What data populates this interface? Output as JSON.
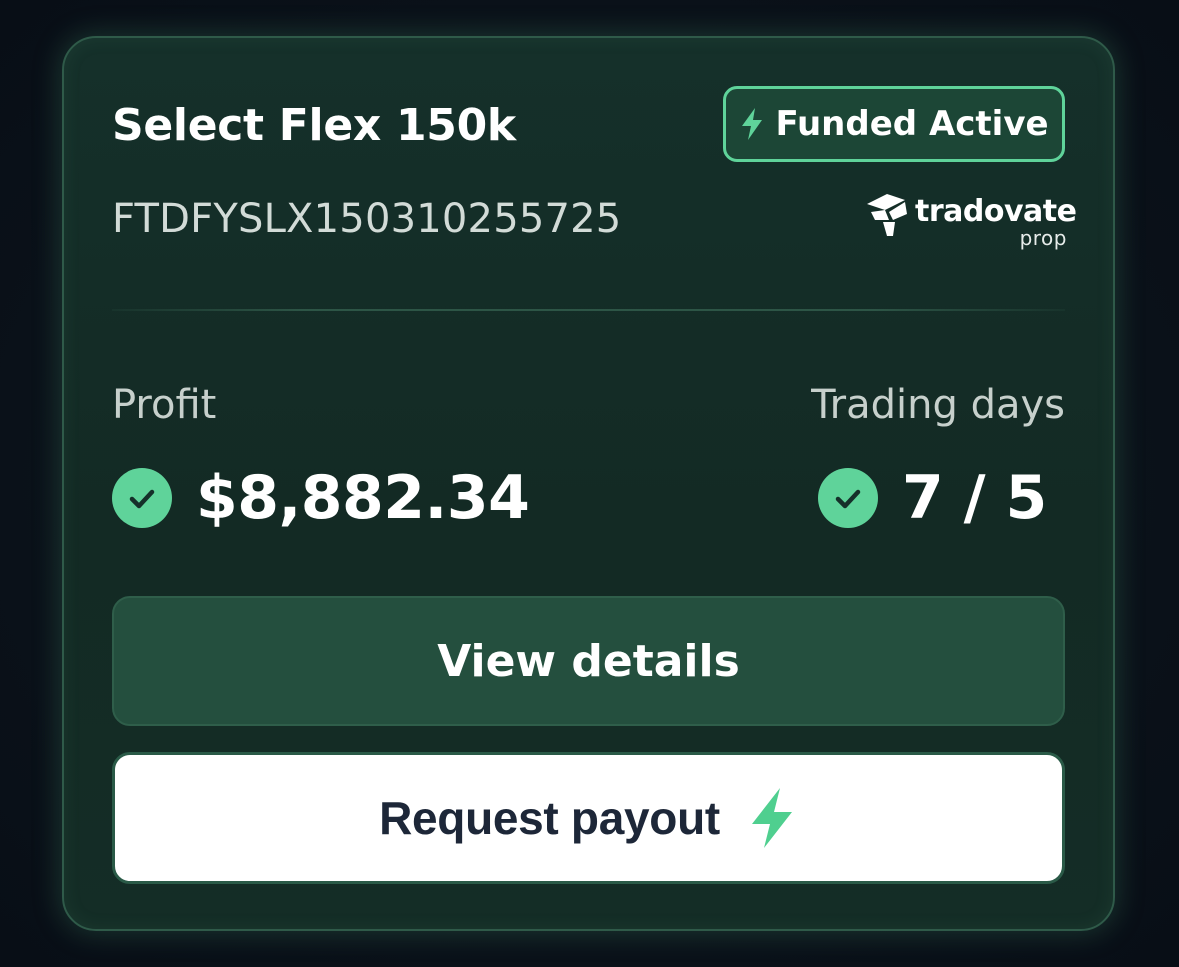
{
  "account": {
    "title": "Select Flex 150k",
    "id": "FTDFYSLX150310255725",
    "status_badge": "Funded Active",
    "status_icon": "lightning-bolt-icon"
  },
  "brand": {
    "name": "tradovate",
    "sub": "prop"
  },
  "stats": {
    "profit": {
      "label": "Profit",
      "value": "$8,882.34",
      "icon": "check-circle-icon"
    },
    "trading_days": {
      "label": "Trading days",
      "value": "7 / 5",
      "icon": "check-circle-icon"
    }
  },
  "actions": {
    "view_details_label": "View details",
    "request_payout_label": "Request payout",
    "request_payout_icon": "lightning-bolt-icon"
  },
  "colors": {
    "accent": "#5fd39a",
    "card_bg": "#15302a",
    "page_bg": "#0b131c",
    "primary_button_bg": "#244f3e",
    "payout_button_bg": "#ffffff",
    "payout_text": "#1d2738"
  }
}
